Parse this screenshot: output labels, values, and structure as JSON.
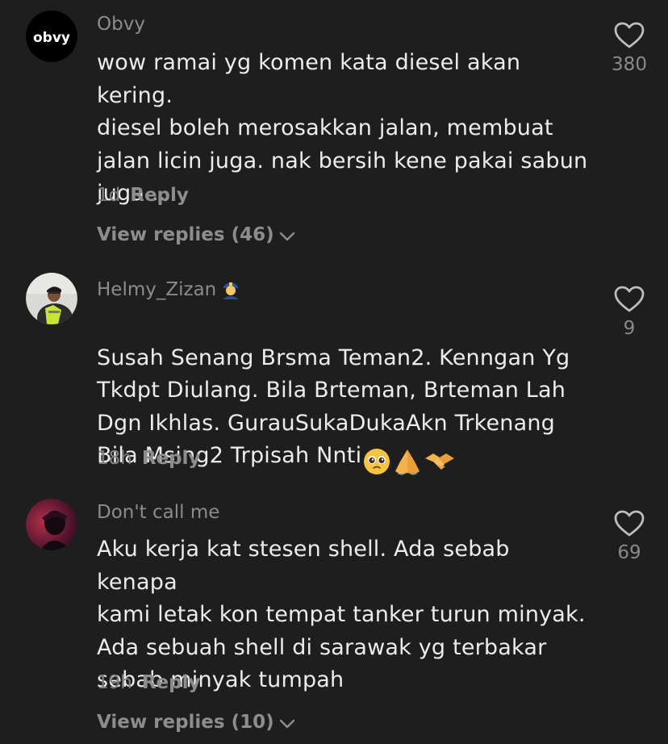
{
  "comments": [
    {
      "username": "Obvy",
      "avatar_text": "obvy",
      "text": "wow ramai yg komen kata diesel akan kering.\ndiesel boleh merosakkan jalan, membuat\njalan licin juga. nak bersih kene pakai sabun\njuga...",
      "time": "1d",
      "reply_label": "Reply",
      "view_replies": "View replies (46)",
      "likes": "380"
    },
    {
      "username": "Helmy_Zizan",
      "badge_icon": "police-officer-emoji",
      "text": "Susah Senang Brsma Teman2. Kenngan Yg\nTkdpt Diulang. Bila Brteman, Brteman Lah\nDgn Ikhlas. GurauSukaDukaAkn Trkenang\nBila Msing2 Trpisah Nnti",
      "emojis": [
        "pleading-face-emoji",
        "folded-hands-emoji",
        "handshake-emoji"
      ],
      "time": "18h",
      "reply_label": "Reply",
      "likes": "9"
    },
    {
      "username": "Don't call me",
      "text": "Aku kerja kat stesen shell. Ada sebab kenapa\nkami letak kon tempat tanker turun minyak.\nAda sebuah shell di sarawak yg terbakar\nsebab minyak tumpah",
      "time": "19h",
      "reply_label": "Reply",
      "view_replies": "View replies (10)",
      "likes": "69"
    }
  ],
  "colors": {
    "background": "#1e1e1e",
    "text": "#ececec",
    "muted": "#8c8c8c"
  }
}
